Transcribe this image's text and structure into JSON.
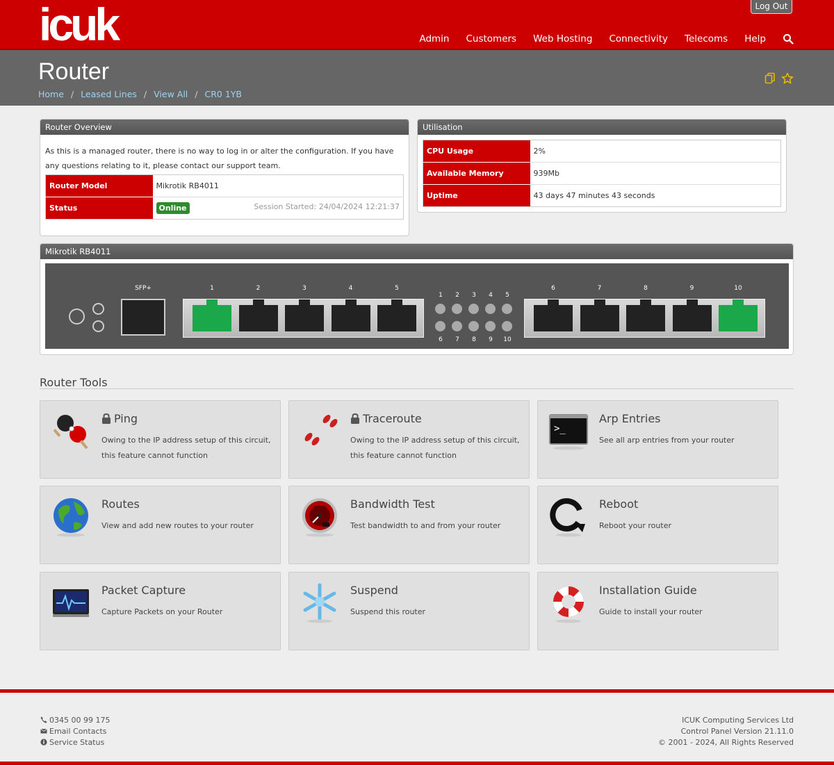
{
  "header": {
    "logo": "icuk",
    "logout_label": "Log Out",
    "nav": [
      "Admin",
      "Customers",
      "Web Hosting",
      "Connectivity",
      "Telecoms",
      "Help"
    ]
  },
  "title": {
    "page_title": "Router",
    "breadcrumb": [
      "Home",
      "Leased Lines",
      "View All",
      "CR0 1YB"
    ],
    "separator": "/"
  },
  "overview": {
    "heading": "Router Overview",
    "intro": "As this is a managed router, there is no way to log in or alter the configuration. If you have any questions relating to it, please contact our support team.",
    "model_label": "Router Model",
    "model_value": "Mikrotik RB4011",
    "status_label": "Status",
    "status_value": "Online",
    "session": "Session Started: 24/04/2024 12:21:37"
  },
  "utilisation": {
    "heading": "Utilisation",
    "rows": [
      {
        "label": "CPU Usage",
        "value": "2%"
      },
      {
        "label": "Available Memory",
        "value": "939Mb"
      },
      {
        "label": "Uptime",
        "value": "43 days 47 minutes 43 seconds"
      }
    ]
  },
  "router_diagram": {
    "heading": "Mikrotik RB4011",
    "sfp_label": "SFP+",
    "ports_left": [
      "1",
      "2",
      "3",
      "4",
      "5"
    ],
    "ports_right": [
      "6",
      "7",
      "8",
      "9",
      "10"
    ],
    "led_top": [
      "1",
      "2",
      "3",
      "4",
      "5"
    ],
    "led_bottom": [
      "6",
      "7",
      "8",
      "9",
      "10"
    ],
    "active_ports": [
      "1",
      "10"
    ],
    "active_color": "#1aa84a"
  },
  "tools": {
    "heading": "Router Tools",
    "items": [
      {
        "name": "Ping",
        "desc": "Owing to the IP address setup of this circuit, this feature cannot function",
        "locked": true,
        "icon": "ping-pong-icon"
      },
      {
        "name": "Traceroute",
        "desc": "Owing to the IP address setup of this circuit, this feature cannot function",
        "locked": true,
        "icon": "footprints-icon"
      },
      {
        "name": "Arp Entries",
        "desc": "See all arp entries from your router",
        "locked": false,
        "icon": "terminal-icon"
      },
      {
        "name": "Routes",
        "desc": "View and add new routes to your router",
        "locked": false,
        "icon": "globe-icon"
      },
      {
        "name": "Bandwidth Test",
        "desc": "Test bandwidth to and from your router",
        "locked": false,
        "icon": "speedometer-icon"
      },
      {
        "name": "Reboot",
        "desc": "Reboot your router",
        "locked": false,
        "icon": "reboot-icon"
      },
      {
        "name": "Packet Capture",
        "desc": "Capture Packets on your Router",
        "locked": false,
        "icon": "monitor-icon"
      },
      {
        "name": "Suspend",
        "desc": "Suspend this router",
        "locked": false,
        "icon": "snowflake-icon"
      },
      {
        "name": "Installation Guide",
        "desc": "Guide to install your router",
        "locked": false,
        "icon": "lifebuoy-icon"
      }
    ]
  },
  "footer": {
    "phone": "0345 00 99 175",
    "email": "Email Contacts",
    "status": "Service Status",
    "company": "ICUK Computing Services Ltd",
    "version": "Control Panel Version 21.11.0",
    "copyright": "© 2001 - 2024, All Rights Reserved"
  },
  "colors": {
    "brand": "#cc0000",
    "titlebar": "#666666",
    "online": "#2e8b2e"
  }
}
